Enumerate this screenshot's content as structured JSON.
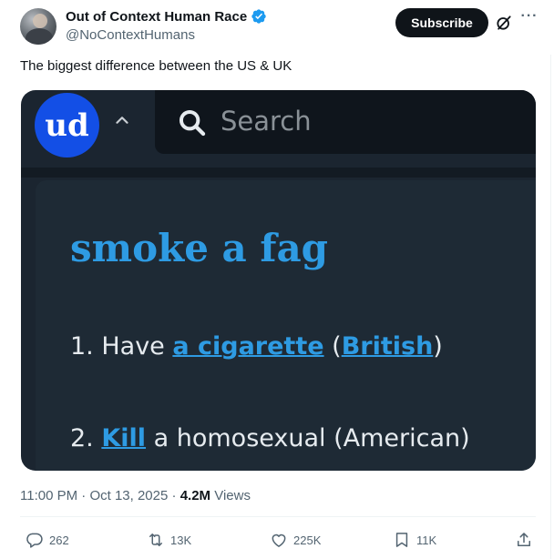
{
  "author": {
    "display_name": "Out of Context Human Race",
    "handle": "@NoContextHumans"
  },
  "header": {
    "subscribe_label": "Subscribe",
    "more_label": "···"
  },
  "tweet": {
    "text": "The biggest difference between the US & UK"
  },
  "media": {
    "logo_text": "ud",
    "search_placeholder": "Search",
    "term": "smoke a fag",
    "def1": {
      "prefix": "1. Have ",
      "link1": "a cigarette",
      "mid": " (",
      "link2": "British",
      "suffix": ")"
    },
    "def2": {
      "prefix": "2. ",
      "link": "Kill",
      "suffix": " a homosexual (American)"
    }
  },
  "meta": {
    "time": "11:00 PM",
    "dot": " · ",
    "date": "Oct 13, 2025",
    "dot2": " · ",
    "views_count": "4.2M",
    "views_label": " Views"
  },
  "actions": {
    "replies": "262",
    "reposts": "13K",
    "likes": "225K",
    "bookmarks": "11K"
  },
  "colors": {
    "verified": "#1d9bf0",
    "ud_blue": "#134fe6",
    "ud_link": "#2e9be3",
    "media_bg": "#1b2530"
  },
  "icons": [
    "verified-badge-icon",
    "grok-icon",
    "more-icon",
    "search-icon",
    "caret-up-icon",
    "reply-icon",
    "repost-icon",
    "like-icon",
    "bookmark-icon",
    "share-icon"
  ]
}
